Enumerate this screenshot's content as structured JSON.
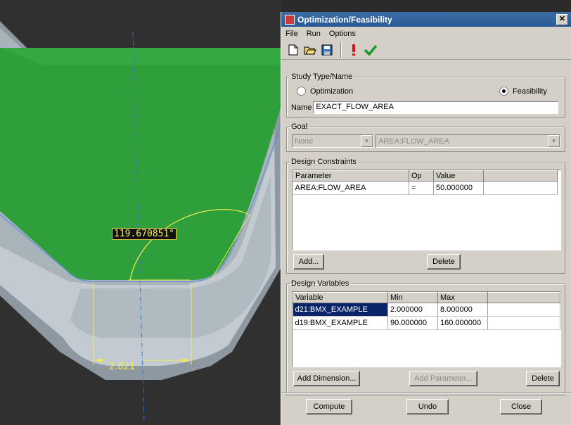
{
  "viewport": {
    "angle_dim": "119.670851°",
    "length_dim": "2.821"
  },
  "dialog": {
    "title": "Optimization/Feasibility",
    "menu": [
      "File",
      "Run",
      "Options"
    ],
    "study": {
      "legend": "Study Type/Name",
      "opt_label": "Optimization",
      "feas_label": "Feasibility",
      "selected": "Feasibility",
      "name_label": "Name",
      "name_value": "EXACT_FLOW_AREA"
    },
    "goal": {
      "legend": "Goal",
      "type": "None",
      "param": "AREA:FLOW_AREA"
    },
    "constraints": {
      "legend": "Design Constraints",
      "headers": [
        "Parameter",
        "Op",
        "Value"
      ],
      "rows": [
        {
          "parameter": "AREA:FLOW_AREA",
          "op": "=",
          "value": "50.000000"
        }
      ],
      "add_label": "Add...",
      "delete_label": "Delete"
    },
    "variables": {
      "legend": "Design Variables",
      "headers": [
        "Variable",
        "Min",
        "Max"
      ],
      "rows": [
        {
          "variable": "d21:BMX_EXAMPLE",
          "min": "2.000000",
          "max": "8.000000"
        },
        {
          "variable": "d19:BMX_EXAMPLE",
          "min": "90.000000",
          "max": "160.000000"
        }
      ],
      "add_dim_label": "Add Dimension...",
      "add_param_label": "Add Parameter...",
      "delete_label": "Delete"
    },
    "footer": {
      "compute": "Compute",
      "undo": "Undo",
      "close": "Close"
    }
  }
}
